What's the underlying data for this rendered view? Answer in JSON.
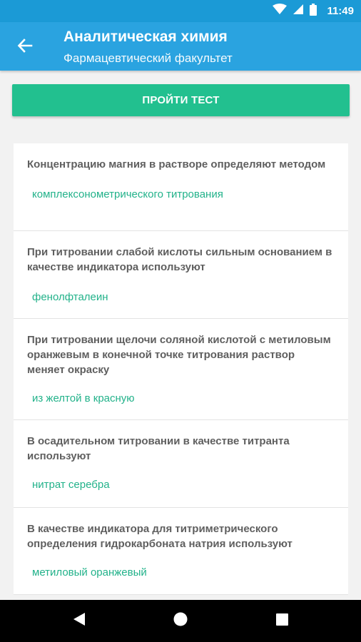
{
  "status_bar": {
    "time": "11:49"
  },
  "toolbar": {
    "title": "Аналитическая химия",
    "subtitle": "Фармацевтический факультет"
  },
  "test_button": {
    "label": "ПРОЙТИ ТЕСТ"
  },
  "cards": [
    {
      "question": "Концентрацию магния в растворе определяют методом",
      "answer": "комплексонометрического титрования"
    },
    {
      "question": "При титровании слабой кислоты сильным основанием в качестве индикатора используют",
      "answer": "фенолфталеин"
    },
    {
      "question": "При титровании щелочи соляной кислотой с метиловым оранжевым в конечной точке титрования раствор меняет окраску",
      "answer": "из желтой в красную"
    },
    {
      "question": "В осадительном титровании в качестве титранта используют",
      "answer": "нитрат серебра"
    },
    {
      "question": "В качестве индикатора для титриметрического определения гидрокарбоната натрия используют",
      "answer": "метиловый оранжевый"
    }
  ],
  "colors": {
    "toolbar": "#2aa3e0",
    "status_bar": "#1b9ad6",
    "accent_green": "#22c08f",
    "answer_text": "#22b28a",
    "question_text": "#5f5f5f"
  },
  "icons": [
    "wifi-icon",
    "signal-icon",
    "battery-icon",
    "back-arrow-icon",
    "nav-back-icon",
    "nav-home-icon",
    "nav-recents-icon"
  ]
}
